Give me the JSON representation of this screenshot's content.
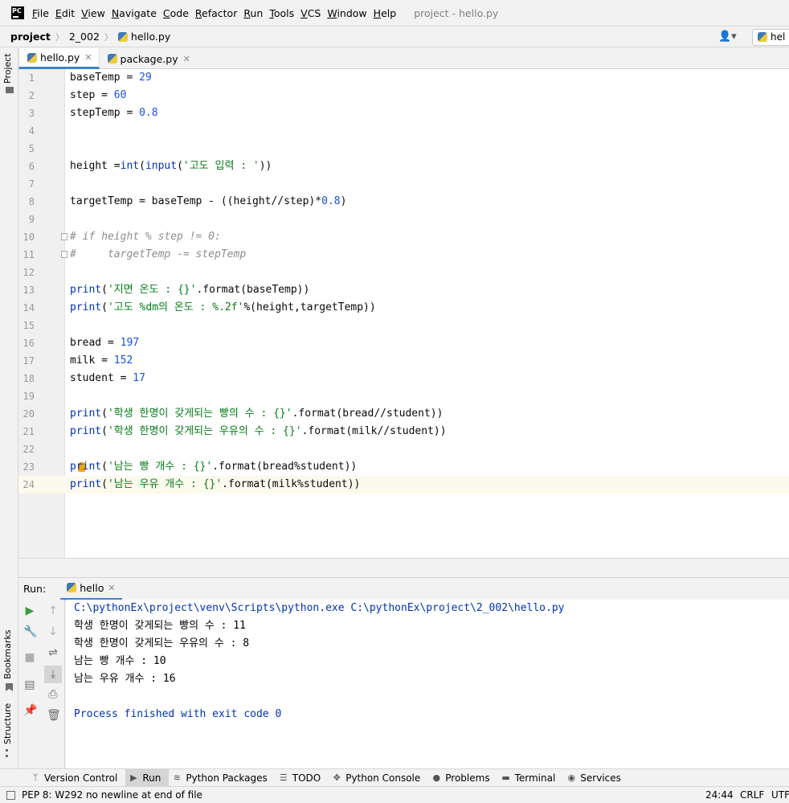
{
  "menubar": {
    "items": [
      "File",
      "Edit",
      "View",
      "Navigate",
      "Code",
      "Refactor",
      "Run",
      "Tools",
      "VCS",
      "Window",
      "Help"
    ],
    "mnemonics": [
      "F",
      "E",
      "V",
      "N",
      "C",
      "R",
      "R",
      "T",
      "V",
      "W",
      "H"
    ],
    "window_title": "project - hello.py"
  },
  "breadcrumb": {
    "project": "project",
    "folder": "2_002",
    "file": "hello.py"
  },
  "run_config_label": "hel",
  "sidebar": {
    "project": "Project",
    "bookmarks": "Bookmarks",
    "structure": "Structure"
  },
  "editor_tabs": [
    {
      "label": "hello.py",
      "active": true
    },
    {
      "label": "package.py",
      "active": false
    }
  ],
  "code_lines": [
    "baseTemp = 29",
    "step = 60",
    "stepTemp = 0.8",
    "",
    "",
    "height =int(input('고도 입력 : '))",
    "",
    "targetTemp = baseTemp - ((height//step)*0.8)",
    "",
    "# if height % step != 0:",
    "#     targetTemp -= stepTemp",
    "",
    "print('지면 온도 : {}'.format(baseTemp))",
    "print('고도 %dm의 온도 : %.2f'%(height,targetTemp))",
    "",
    "bread = 197",
    "milk = 152",
    "student = 17",
    "",
    "print('학생 한명이 갖게되는 빵의 수 : {}'.format(bread//student))",
    "print('학생 한명이 갖게되는 우유의 수 : {}'.format(milk//student))",
    "",
    "print('남는 빵 개수 : {}'.format(bread%student))",
    "print('남는 우유 개수 : {}'.format(milk%student))"
  ],
  "current_line": 24,
  "run_panel": {
    "label": "Run:",
    "tab": "hello",
    "output": [
      "C:\\pythonEx\\project\\venv\\Scripts\\python.exe C:\\pythonEx\\project\\2_002\\hello.py",
      "학생 한명이 갖게되는 빵의 수 : 11",
      "학생 한명이 갖게되는 우유의 수 : 8",
      "남는 빵 개수 : 10",
      "남는 우유 개수 : 16",
      "",
      "Process finished with exit code 0"
    ]
  },
  "bottom_tabs": [
    {
      "label": "Version Control",
      "icon": "branch-icon"
    },
    {
      "label": "Run",
      "icon": "play-icon",
      "active": true
    },
    {
      "label": "Python Packages",
      "icon": "layers-icon"
    },
    {
      "label": "TODO",
      "icon": "list-icon"
    },
    {
      "label": "Python Console",
      "icon": "console-icon"
    },
    {
      "label": "Problems",
      "icon": "info-icon"
    },
    {
      "label": "Terminal",
      "icon": "terminal-icon"
    },
    {
      "label": "Services",
      "icon": "services-icon"
    }
  ],
  "status": {
    "message": "PEP 8: W292 no newline at end of file",
    "position": "24:44",
    "line_sep": "CRLF",
    "encoding": "UTF-"
  },
  "colors": {
    "accent": "#4083c9",
    "keyword": "#0033b3",
    "number": "#1750eb",
    "string": "#067d17",
    "comment": "#8c8c8c",
    "console_cmd": "#0033b3"
  }
}
